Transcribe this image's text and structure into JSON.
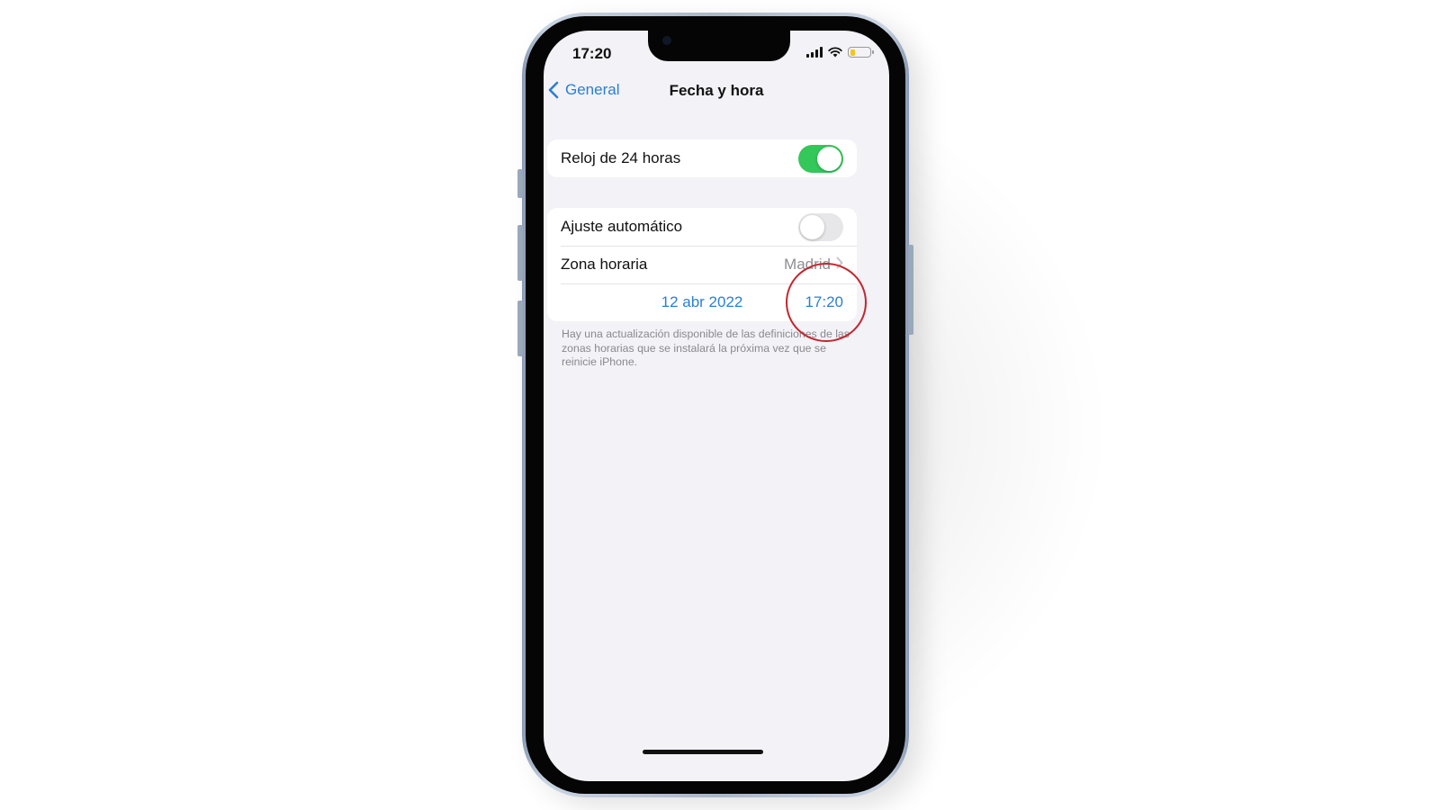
{
  "status_bar": {
    "time": "17:20",
    "signal_icon": "cellular-signal-icon",
    "wifi_icon": "wifi-icon",
    "battery_icon": "battery-low-icon",
    "battery_level_fraction": 0.25,
    "battery_color": "#f5c518"
  },
  "nav": {
    "back_label": "General",
    "title": "Fecha y hora"
  },
  "settings": {
    "clock_24h": {
      "label": "Reloj de 24 horas",
      "enabled": true
    },
    "auto_set": {
      "label": "Ajuste automático",
      "enabled": false
    },
    "time_zone": {
      "label": "Zona horaria",
      "value": "Madrid"
    },
    "date_value": "12 abr 2022",
    "time_value": "17:20"
  },
  "footnote": "Hay una actualización disponible de las definiciones de las zonas horarias que se instalará la próxima vez que se reinicie iPhone.",
  "colors": {
    "accent_blue": "#2b7fd4",
    "toggle_on": "#34c759",
    "toggle_off": "#e7e7ea",
    "highlight_circle": "#c3262f",
    "screen_background": "#f2f2f7"
  },
  "annotation": {
    "highlight_target": "time_value"
  }
}
